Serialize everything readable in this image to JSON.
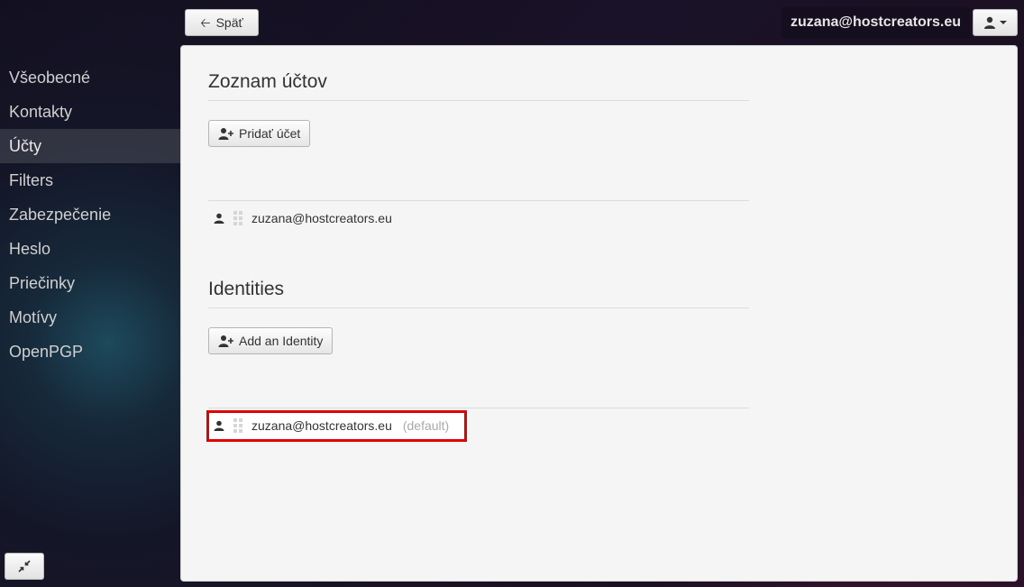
{
  "header": {
    "back_label": "Späť",
    "user_email": "zuzana@hostcreators.eu"
  },
  "sidebar": {
    "items": [
      {
        "label": "Všeobecné"
      },
      {
        "label": "Kontakty"
      },
      {
        "label": "Účty",
        "active": true
      },
      {
        "label": "Filters"
      },
      {
        "label": "Zabezpečenie"
      },
      {
        "label": "Heslo"
      },
      {
        "label": "Priečinky"
      },
      {
        "label": "Motívy"
      },
      {
        "label": "OpenPGP"
      }
    ]
  },
  "accounts": {
    "title": "Zoznam účtov",
    "add_label": "Pridať účet",
    "items": [
      {
        "email": "zuzana@hostcreators.eu"
      }
    ]
  },
  "identities": {
    "title": "Identities",
    "add_label": "Add an Identity",
    "items": [
      {
        "email": "zuzana@hostcreators.eu",
        "tag": "(default)",
        "highlighted": true
      }
    ]
  },
  "icons": {
    "back": "arrow-left-icon",
    "user": "user-icon",
    "add_user": "user-plus-icon",
    "drag": "drag-handle-icon",
    "collapse": "collapse-icon"
  },
  "colors": {
    "highlight": "#e00000",
    "panel_bg": "#f5f5f5"
  }
}
